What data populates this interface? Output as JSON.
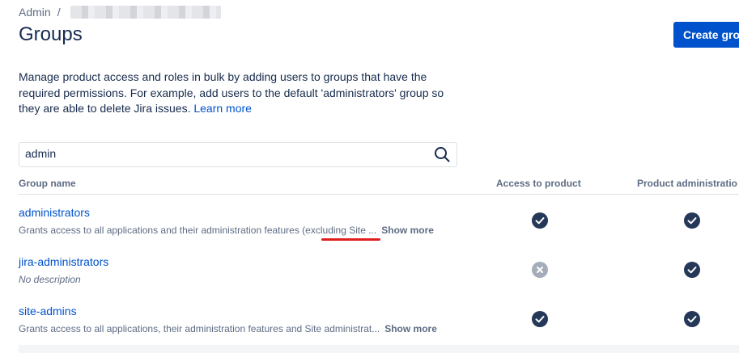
{
  "breadcrumb": {
    "root": "Admin",
    "separator": "/"
  },
  "page": {
    "title": "Groups"
  },
  "actions": {
    "create_label": "Create gro"
  },
  "description": {
    "text": "Manage product access and roles in bulk by adding users to groups that have the required permissions. For example, add users to the default 'administrators' group so they are able to delete Jira issues. ",
    "link": "Learn more"
  },
  "search": {
    "value": "admin",
    "icon": "search-icon"
  },
  "table": {
    "headers": {
      "name": "Group name",
      "access": "Access to product",
      "admin": "Product administratio"
    },
    "rows": [
      {
        "name": "administrators",
        "description": "Grants access to all applications and their administration features (excluding Site ...",
        "show_more": "Show more",
        "access": "granted",
        "admin": "granted"
      },
      {
        "name": "jira-administrators",
        "description": "No description",
        "access": "denied",
        "admin": "granted"
      },
      {
        "name": "site-admins",
        "description": "Grants access to all applications, their administration features and Site administrat...",
        "show_more": "Show more",
        "access": "granted",
        "admin": "granted"
      }
    ]
  },
  "colors": {
    "accent": "#0052cc",
    "granted": "#253858",
    "denied": "#a5adba",
    "annotation": "#e01e1e"
  }
}
